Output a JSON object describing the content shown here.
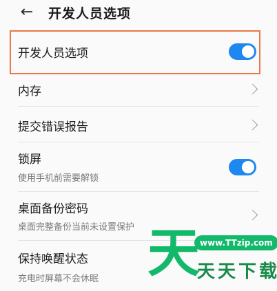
{
  "header": {
    "back_icon": "arrow-left-icon",
    "title": "开发人员选项"
  },
  "rows": [
    {
      "label": "开发人员选项",
      "control": "toggle",
      "on": true
    },
    {
      "label": "内存",
      "control": "chevron-right-icon"
    },
    {
      "label": "提交错误报告",
      "control": "chevron-right-icon"
    },
    {
      "label": "锁屏",
      "sub": "使用手机前需要解锁",
      "control": "toggle",
      "on": true
    },
    {
      "label": "桌面备份密码",
      "sub": "桌面完整备份当前未设置保护",
      "control": "chevron-right-icon"
    },
    {
      "label": "保持唤醒状态",
      "sub": "充电时屏幕不会休眠"
    }
  ],
  "watermark": {
    "char": "天",
    "url": "www.TTzip.com",
    "name": "天天下载"
  },
  "colors": {
    "toggle_on": "#1e88f0",
    "highlight": "#e8774a",
    "watermark": "#12b96a"
  }
}
